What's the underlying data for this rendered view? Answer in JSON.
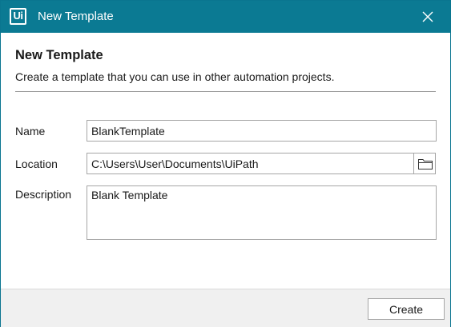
{
  "window": {
    "title": "New Template",
    "logo_text": "Ui",
    "close_icon": "close-icon",
    "accent_color": "#0b7a93"
  },
  "header": {
    "title": "New Template",
    "subtitle": "Create a template that you can use in other automation projects."
  },
  "form": {
    "name": {
      "label": "Name",
      "value": "BlankTemplate"
    },
    "location": {
      "label": "Location",
      "value": "C:\\Users\\User\\Documents\\UiPath",
      "browse_icon": "folder-icon"
    },
    "description": {
      "label": "Description",
      "value": "Blank Template"
    }
  },
  "footer": {
    "create_label": "Create"
  }
}
